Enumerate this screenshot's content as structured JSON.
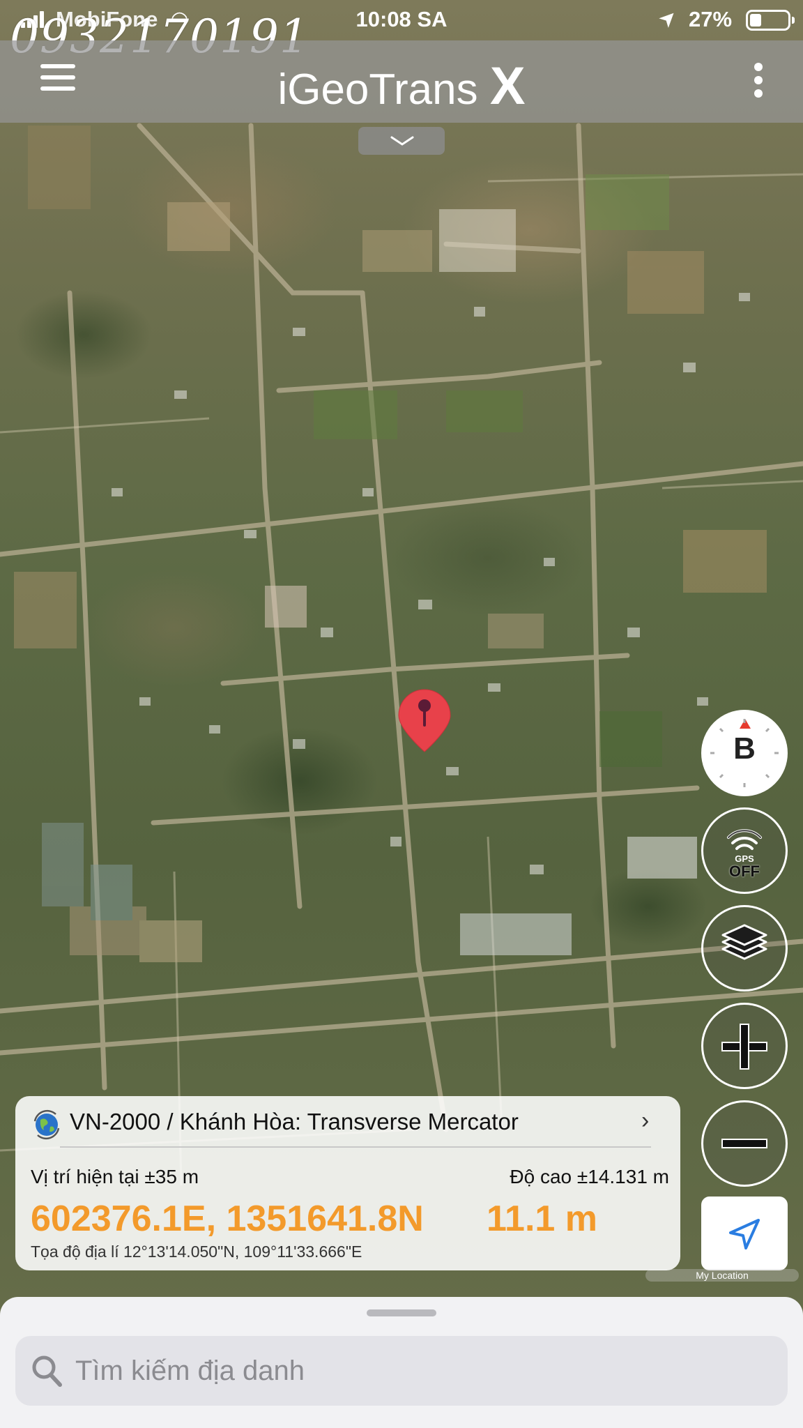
{
  "status_bar": {
    "carrier": "MobiFone",
    "time": "10:08 SA",
    "battery_percent": "27%",
    "battery_level": 0.27
  },
  "watermark": "0932170191",
  "app": {
    "title": "iGeoTrans",
    "title_suffix": "X"
  },
  "map_controls": {
    "compass_label": "B",
    "gps_small": "GPS",
    "gps_state": "OFF",
    "my_location_label": "My Location"
  },
  "coordinate_card": {
    "crs": "VN-2000 / Khánh Hòa: Transverse Mercator",
    "position_label": "Vị trí hiện tại ±35 m",
    "altitude_label": "Độ cao ±14.131 m",
    "coordinates": "602376.1E, 1351641.8N",
    "altitude": "11.1 m",
    "geographic": "Tọa độ địa lí 12°13'14.050\"N, 109°11'33.666\"E"
  },
  "search": {
    "placeholder": "Tìm kiếm địa danh"
  },
  "colors": {
    "accent_orange": "#f39a2b",
    "pin_red": "#e8414a",
    "my_location_blue": "#2a7de1"
  },
  "icons": [
    "menu-icon",
    "more-icon",
    "chevron-down-icon",
    "map-pin-icon",
    "compass-icon",
    "gps-icon",
    "layers-icon",
    "zoom-in-icon",
    "zoom-out-icon",
    "navigation-arrow-icon",
    "globe-icon",
    "chevron-right-icon",
    "search-icon"
  ]
}
